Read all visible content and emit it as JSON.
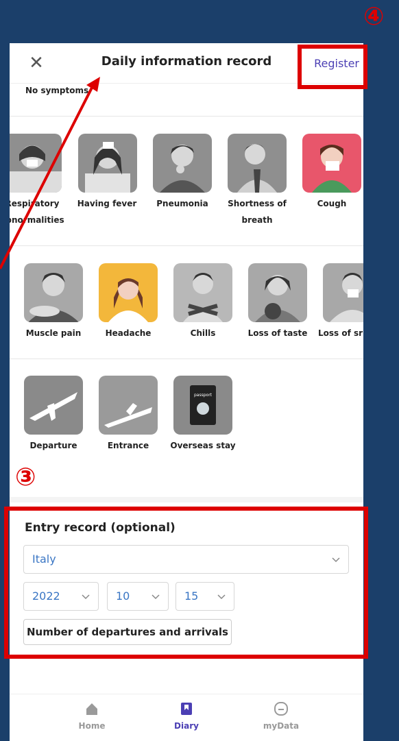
{
  "header": {
    "title": "Daily information record",
    "close_icon": "close-icon",
    "register_label": "Register"
  },
  "no_symptoms_label": "No symptoms",
  "row1": [
    {
      "label": "Respiratory\nabnormalities",
      "icon": "respiratory-icon"
    },
    {
      "label": "Having fever",
      "icon": "fever-icon"
    },
    {
      "label": "Pneumonia",
      "icon": "pneumonia-icon"
    },
    {
      "label": "Shortness of\nbreath",
      "icon": "shortness-of-breath-icon"
    },
    {
      "label": "Cough",
      "icon": "cough-icon"
    }
  ],
  "row2": [
    {
      "label": "Muscle pain",
      "icon": "muscle-pain-icon"
    },
    {
      "label": "Headache",
      "icon": "headache-icon"
    },
    {
      "label": "Chills",
      "icon": "chills-icon"
    },
    {
      "label": "Loss of taste",
      "icon": "loss-of-taste-icon"
    },
    {
      "label": "Loss of sr",
      "icon": "loss-of-smell-icon"
    }
  ],
  "row3": [
    {
      "label": "Departure",
      "icon": "departure-plane-icon"
    },
    {
      "label": "Entrance",
      "icon": "entrance-plane-icon"
    },
    {
      "label": "Overseas stay",
      "icon": "passport-icon",
      "passport_text": "passport"
    }
  ],
  "entry": {
    "title": "Entry record (optional)",
    "country": "Italy",
    "year": "2022",
    "month": "10",
    "day": "15",
    "button_label": "Number of departures and arrivals"
  },
  "tabbar": [
    {
      "label": "Home",
      "icon": "home-icon",
      "active": false
    },
    {
      "label": "Diary",
      "icon": "diary-icon",
      "active": true
    },
    {
      "label": "myData",
      "icon": "mydata-icon",
      "active": false
    }
  ],
  "annotations": {
    "marker3": "③",
    "marker4": "④"
  },
  "colors": {
    "background": "#1b3f6a",
    "accent": "#4b3fb4",
    "highlight_red": "#dd0000",
    "select_text": "#3a76c4",
    "cough_bg": "#e8566b",
    "headache_bg": "#f3b73b"
  }
}
